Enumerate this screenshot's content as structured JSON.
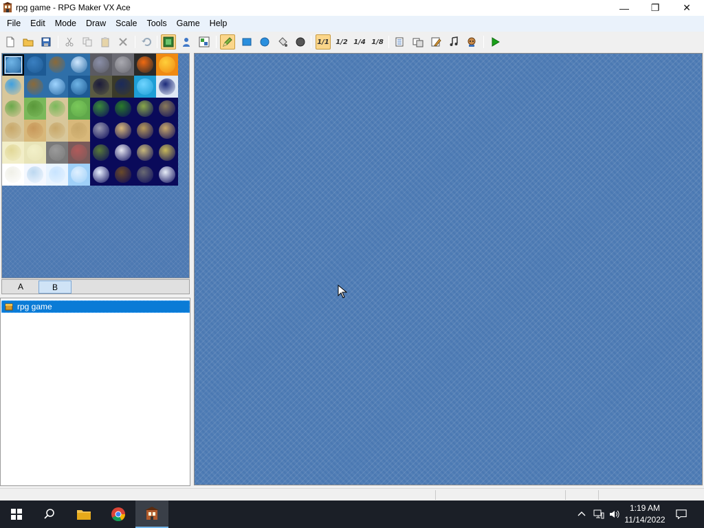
{
  "window": {
    "title": "rpg game - RPG Maker VX Ace",
    "minimize": "—",
    "restore": "❐",
    "close": "✕"
  },
  "menu": [
    "File",
    "Edit",
    "Mode",
    "Draw",
    "Scale",
    "Tools",
    "Game",
    "Help"
  ],
  "toolbar": {
    "scale_1_1": "1/1",
    "scale_1_2": "1/2",
    "scale_1_4": "1/4",
    "scale_1_8": "1/8"
  },
  "tileset": {
    "tabs": [
      "A",
      "B"
    ],
    "selected_tab": "B"
  },
  "map_tree": {
    "project": "rpg game"
  },
  "taskbar": {
    "time": "1:19 AM",
    "date": "11/14/2022"
  },
  "colors": {
    "map_bg": "#4f7db6",
    "tree_selection": "#0a7bd6",
    "taskbar": "#1b1f27",
    "play_green": "#1aa11a"
  }
}
